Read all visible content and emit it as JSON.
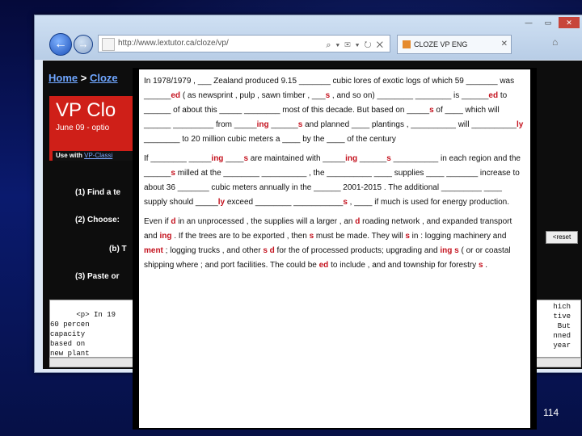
{
  "browser": {
    "window_controls": [
      "—",
      "▭",
      "✕"
    ],
    "address": "http://www.lextutor.ca/cloze/vp/",
    "tab_title": "CLOZE VP ENG",
    "back_label": "←",
    "forward_label": "→"
  },
  "page": {
    "breadcrumb_home": "Home",
    "breadcrumb_sep": " > ",
    "breadcrumb_current": "Cloze",
    "banner_title": "VP Clo",
    "banner_sub": "June 09 - optio",
    "banner_use": "Use with ",
    "banner_use_link": "VP-Classi",
    "step1": "(1) Find a te",
    "step2": "(2) Choose:",
    "step2b": "(b) T",
    "step3": "(3) Paste or",
    "reset_label": "<reset",
    "code_left": "<p> In 19\n60 percen\ncapacity\nbased on\nnew plant",
    "code_right": "hich\ntive\n But\nnned\n year"
  },
  "doc": {
    "p1": [
      {
        "t": "In 1978/1979 , ___ Zealand produced 9.15 _______ cubic lores of exotic logs of which 59 _______ was ______"
      },
      {
        "t": "ed",
        "r": true
      },
      {
        "t": " ( as newsprint , pulp , sawn timber , ___"
      },
      {
        "t": "s",
        "r": true
      },
      {
        "t": " , and so on) ________ ________ is ______"
      },
      {
        "t": "ed",
        "r": true
      },
      {
        "t": " to ______ of about this _____ ________ most of this decade. But based on _____"
      },
      {
        "t": "s",
        "r": true
      },
      {
        "t": " of ____ which will ______ _________ from _____"
      },
      {
        "t": "ing",
        "r": true
      },
      {
        "t": " ______"
      },
      {
        "t": "s",
        "r": true
      },
      {
        "t": " and planned ____ plantings , __________ will __________"
      },
      {
        "t": "ly",
        "r": true
      },
      {
        "t": " ________ to 20 million cubic meters a ____ by the ____ of the century"
      }
    ],
    "p2": [
      {
        "t": "If ________ _____"
      },
      {
        "t": "ing",
        "r": true
      },
      {
        "t": " ____"
      },
      {
        "t": "s",
        "r": true
      },
      {
        "t": " are maintained with _____"
      },
      {
        "t": "ing",
        "r": true
      },
      {
        "t": " ______"
      },
      {
        "t": "s",
        "r": true
      },
      {
        "t": " __________ in each region and the ______"
      },
      {
        "t": "s",
        "r": true
      },
      {
        "t": " milled at the ________ __________ , the __________ ____ supplies ____ _______ increase to about 36 _______ cubic meters annually in the ______ 2001-2015 . The additional _________ ____ supply should _____"
      },
      {
        "t": "ly",
        "r": true
      },
      {
        "t": " exceed ________ ___________"
      },
      {
        "t": "s",
        "r": true
      },
      {
        "t": " , ____ if much is used for energy production."
      }
    ],
    "p3": [
      {
        "t": "Even if "
      },
      {
        "t": "d",
        "r": true
      },
      {
        "t": " in an unprocessed , the supplies will a larger , an "
      },
      {
        "t": "d",
        "r": true
      },
      {
        "t": " roading network , and expanded transport and "
      },
      {
        "t": "ing",
        "r": true
      },
      {
        "t": " . If the trees are to be exported , then "
      },
      {
        "t": "s",
        "r": true
      },
      {
        "t": " must be made. They will "
      },
      {
        "t": "s",
        "r": true
      },
      {
        "t": " in : logging machinery and "
      },
      {
        "t": "ment",
        "r": true
      },
      {
        "t": " ; logging trucks , and other "
      },
      {
        "t": "s",
        "r": true
      },
      {
        "t": " "
      },
      {
        "t": "d",
        "r": true
      },
      {
        "t": " for the of processed products; upgrading and "
      },
      {
        "t": "ing",
        "r": true
      },
      {
        "t": " "
      },
      {
        "t": "s",
        "r": true
      },
      {
        "t": " ( or or coastal shipping where ; and port facilities. The could be "
      },
      {
        "t": "ed",
        "r": true
      },
      {
        "t": " to include , and and township for forestry "
      },
      {
        "t": "s",
        "r": true
      },
      {
        "t": " ."
      }
    ]
  },
  "slide_number": "114"
}
